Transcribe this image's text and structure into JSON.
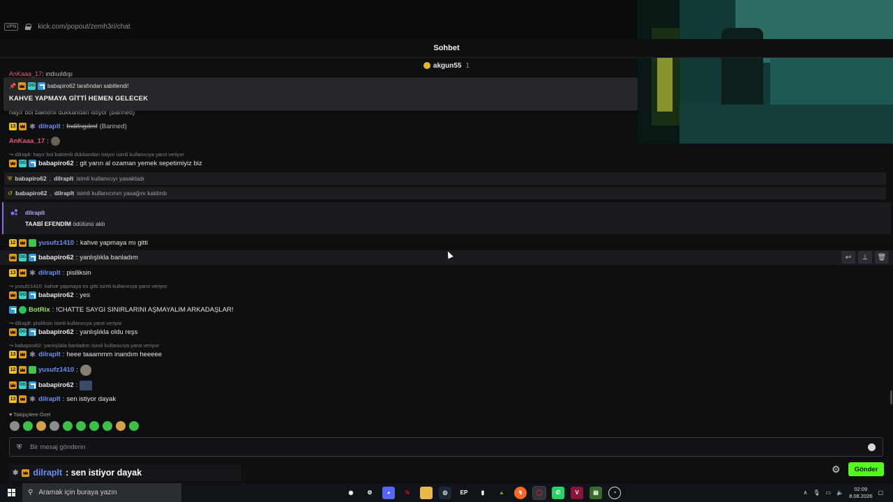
{
  "browser": {
    "vpn_label": "VPN",
    "url": "kick.com/popout/zemh3ri/chat"
  },
  "chat": {
    "title": "Sohbet",
    "leaderboard": {
      "user": "akgun55",
      "count": "1"
    },
    "cut_line": {
      "user": "AnKaaa_17",
      "text": "ındıuıldışı"
    },
    "pinned": {
      "pinned_by": "babapiro62 tarafından sabitlendi!",
      "message": "KAHVE YAPMAYA GİTTİ HEMEN GELECEK",
      "ghost_text": "hayır bol bakterili dükkandan istiyor (Banned)"
    },
    "messages": [
      {
        "user": "dilraplt",
        "badge_num": "13",
        "text": "fndifngdmf",
        "tag": "(Banned)",
        "deleted": true
      },
      {
        "user": "AnKaaa_17",
        "text": "",
        "emote": "monkey"
      },
      {
        "reply": "dilraplt: hayır bol bakterili dükkandan istiyor isimli kullanıcıya yanıt veriyor",
        "user": "babapiro62",
        "text": "git yarın al ozaman yemek sepetimiyiz biz"
      },
      {
        "user": "yusufz1410",
        "badge_num": "12",
        "text": "kahve yapmaya mı gitti"
      },
      {
        "user": "babapiro62",
        "text": "yanlışlıkla banladım"
      },
      {
        "user": "dilraplt",
        "badge_num": "13",
        "text": "pisiliksin"
      },
      {
        "reply": "yusufz1410: kahve yapmaya mı gitti isimli kullanıcıya yanıt veriyor",
        "user": "babapiro62",
        "text": "yes"
      },
      {
        "user": "BotRix",
        "text": "!CHATTE SAYGI SINIRLARINI AŞMAYALIM ARKADAŞLAR!"
      },
      {
        "reply": "dilraplt: pisiliksin isimli kullanıcıya yanıt veriyor",
        "user": "babapiro62",
        "text": "yanlışlıkla oldu reşs"
      },
      {
        "reply": "babapiro62: yanlışlıkla banladım isimli kullanıcıya yanıt veriyor",
        "user": "dilraplt",
        "badge_num": "13",
        "text": "heee taaammm inandım heeeee"
      },
      {
        "user": "yusufz1410",
        "badge_num": "12",
        "text": "",
        "emote": "face"
      },
      {
        "user": "babapiro62",
        "text": "",
        "emote": "figure"
      },
      {
        "user": "dilraplt",
        "badge_num": "13",
        "text": "sen istiyor dayak"
      }
    ],
    "system": [
      {
        "actor": "babapiro62",
        "target": "dilraplt",
        "text": "isimli kullanıcıyı yasakladı"
      },
      {
        "actor": "babapiro62",
        "target": "dilraplt",
        "text": "isimli kullanıcının yasağını kaldırdı"
      }
    ],
    "reward": {
      "user": "dilraplt",
      "reward_name": "TAABİ EFENDİM",
      "text": "ödülünü aldı"
    },
    "followers_label": "Takipçilere Özel",
    "input_placeholder": "Bir mesaj gönderin",
    "send_label": "Gönder",
    "overlay": {
      "user": "dilraplt",
      "text": ": sen istiyor dayak"
    },
    "accent": "#53fc18"
  },
  "taskbar": {
    "search_placeholder": "Aramak için buraya yazın",
    "time": "02:09",
    "date": "8.08.2026"
  }
}
